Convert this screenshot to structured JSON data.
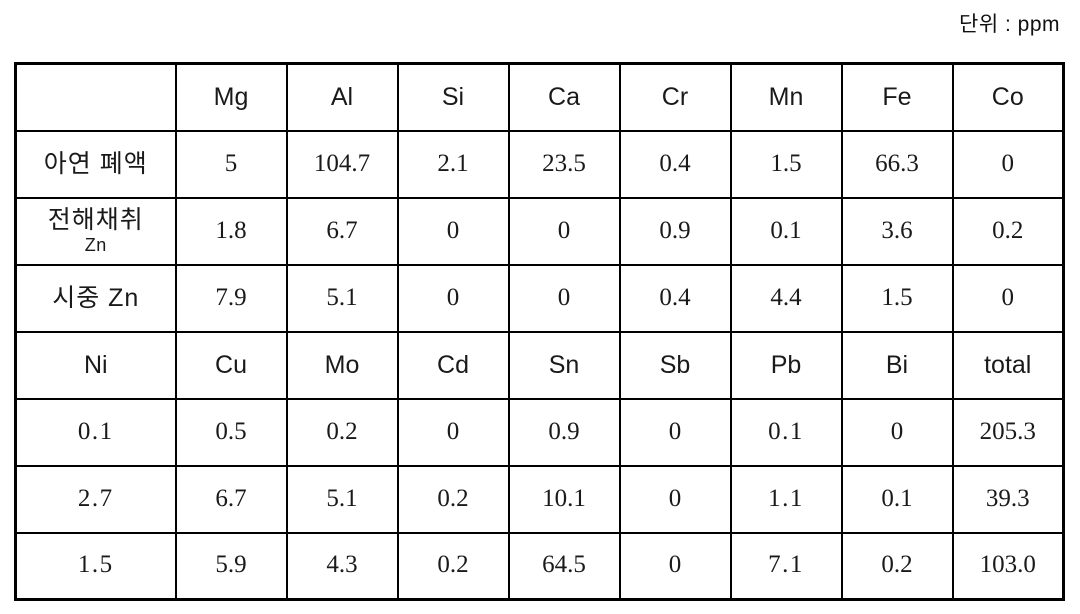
{
  "unit_note": "단위 : ppm",
  "table": {
    "section1": {
      "corner_label": "",
      "headers": [
        "Mg",
        "Al",
        "Si",
        "Ca",
        "Cr",
        "Mn",
        "Fe",
        "Co"
      ],
      "rows": [
        {
          "label": "아연 폐액",
          "label_line2": "",
          "values": [
            "5",
            "104.7",
            "2.1",
            "23.5",
            "0.4",
            "1.5",
            "66.3",
            "0"
          ]
        },
        {
          "label": "전해채취",
          "label_line2": "Zn",
          "values": [
            "1.8",
            "6.7",
            "0",
            "0",
            "0.9",
            "0.1",
            "3.6",
            "0.2"
          ]
        },
        {
          "label": "시중 Zn",
          "label_line2": "",
          "values": [
            "7.9",
            "5.1",
            "0",
            "0",
            "0.4",
            "4.4",
            "1.5",
            "0"
          ]
        }
      ]
    },
    "section2": {
      "headers": [
        "Ni",
        "Cu",
        "Mo",
        "Cd",
        "Sn",
        "Sb",
        "Pb",
        "Bi",
        "total"
      ],
      "rows": [
        {
          "values": [
            "0.1",
            "0.5",
            "0.2",
            "0",
            "0.9",
            "0",
            "0.1",
            "0",
            "205.3"
          ]
        },
        {
          "values": [
            "2.7",
            "6.7",
            "5.1",
            "0.2",
            "10.1",
            "0",
            "1.1",
            "0.1",
            "39.3"
          ]
        },
        {
          "values": [
            "1.5",
            "5.9",
            "4.3",
            "0.2",
            "64.5",
            "0",
            "7.1",
            "0.2",
            "103.0"
          ]
        }
      ]
    }
  },
  "chart_data": {
    "type": "table",
    "title": "",
    "unit": "ppm",
    "columns_block1": [
      "",
      "Mg",
      "Al",
      "Si",
      "Ca",
      "Cr",
      "Mn",
      "Fe",
      "Co"
    ],
    "columns_block2": [
      "Ni",
      "Cu",
      "Mo",
      "Cd",
      "Sn",
      "Sb",
      "Pb",
      "Bi",
      "total"
    ],
    "row_labels": [
      "아연 폐액",
      "전해채취 Zn",
      "시중 Zn"
    ],
    "block1_values": [
      [
        5,
        104.7,
        2.1,
        23.5,
        0.4,
        1.5,
        66.3,
        0
      ],
      [
        1.8,
        6.7,
        0,
        0,
        0.9,
        0.1,
        3.6,
        0.2
      ],
      [
        7.9,
        5.1,
        0,
        0,
        0.4,
        4.4,
        1.5,
        0
      ]
    ],
    "block2_values": [
      [
        0.1,
        0.5,
        0.2,
        0,
        0.9,
        0,
        0.1,
        0,
        205.3
      ],
      [
        2.7,
        6.7,
        5.1,
        0.2,
        10.1,
        0,
        1.1,
        0.1,
        39.3
      ],
      [
        1.5,
        5.9,
        4.3,
        0.2,
        64.5,
        0,
        7.1,
        0.2,
        103.0
      ]
    ]
  }
}
